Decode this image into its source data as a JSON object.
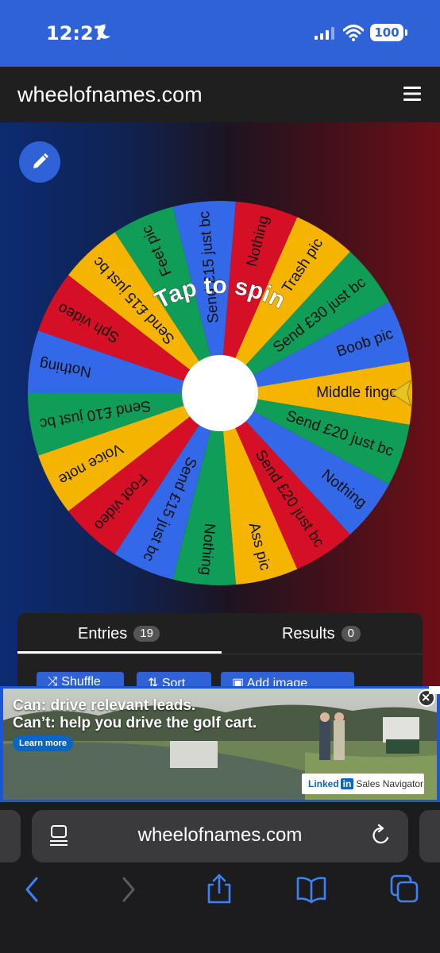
{
  "status_bar": {
    "time": "12:27",
    "battery": "100"
  },
  "header": {
    "site": "wheelofnames.com"
  },
  "wheel": {
    "spin_text": "Tap to spin",
    "entries": [
      "Middle finger",
      "Send £20 just bc",
      "Nothing",
      "Send £20 just bc",
      "Ass pic",
      "Nothing",
      "Send £15 just bc",
      "Foot video",
      "Voice note",
      "Send £10 just bc",
      "Nothing",
      "Sph video",
      "Send £15 just bc",
      "Feet pic",
      "Send £15 just bc",
      "Nothing",
      "Trash pic",
      "Send £30 just bc",
      "Boob pic"
    ],
    "colors": [
      "#f4b400",
      "#0f9d58",
      "#3369e8",
      "#d50f25"
    ]
  },
  "panel": {
    "tab_entries": "Entries",
    "entries_count": "19",
    "tab_results": "Results",
    "results_count": "0",
    "btn_shuffle": "Shuffle",
    "btn_sort": "Sort",
    "btn_add_image": "Add image"
  },
  "ad": {
    "line1": "Can: drive relevant leads.",
    "line2": "Can’t: help you drive the golf cart.",
    "cta": "Learn more",
    "brand_pre": "Linked",
    "brand_in": "in",
    "brand_post": "Sales Navigator"
  },
  "browser": {
    "url": "wheelofnames.com"
  }
}
